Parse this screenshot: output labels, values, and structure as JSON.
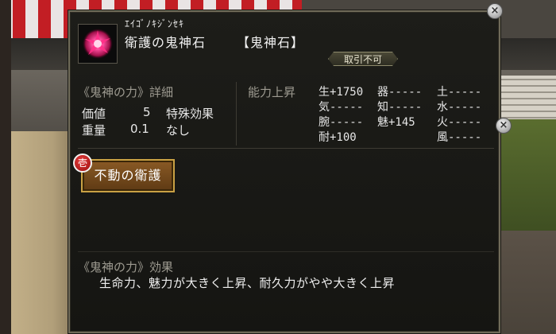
{
  "item": {
    "reading": "ｴｲｺﾞﾉｷｼﾞﾝｾｷ",
    "name": "衛護の鬼神石",
    "category": "【鬼神石】",
    "trade_status": "取引不可"
  },
  "details": {
    "heading": "《鬼神の力》詳細",
    "value_label": "価値",
    "value": "5",
    "weight_label": "重量",
    "weight": "0.1",
    "special_label": "特殊効果",
    "special_value": "なし"
  },
  "ability": {
    "heading": "能力上昇",
    "stats": [
      {
        "label": "生",
        "value": "+1750"
      },
      {
        "label": "気",
        "value": "-----"
      },
      {
        "label": "腕",
        "value": "-----"
      },
      {
        "label": "耐",
        "value": "+100"
      },
      {
        "label": "器",
        "value": "-----"
      },
      {
        "label": "知",
        "value": "-----"
      },
      {
        "label": "魅",
        "value": "+145"
      },
      {
        "label": "土",
        "value": "-----"
      },
      {
        "label": "水",
        "value": "-----"
      },
      {
        "label": "火",
        "value": "-----"
      },
      {
        "label": "風",
        "value": "-----"
      }
    ]
  },
  "skill": {
    "badge": "壱",
    "label": "不動の衛護"
  },
  "effect": {
    "heading": "《鬼神の力》効果",
    "text": "生命力、魅力が大きく上昇、耐久力がやや大きく上昇"
  },
  "controls": {
    "close_glyph": "×"
  },
  "colors": {
    "panel_bg": "#1a1a17",
    "panel_border": "#6f6a58",
    "skill_button": "#7a4e1f",
    "badge_red": "#c42424"
  }
}
